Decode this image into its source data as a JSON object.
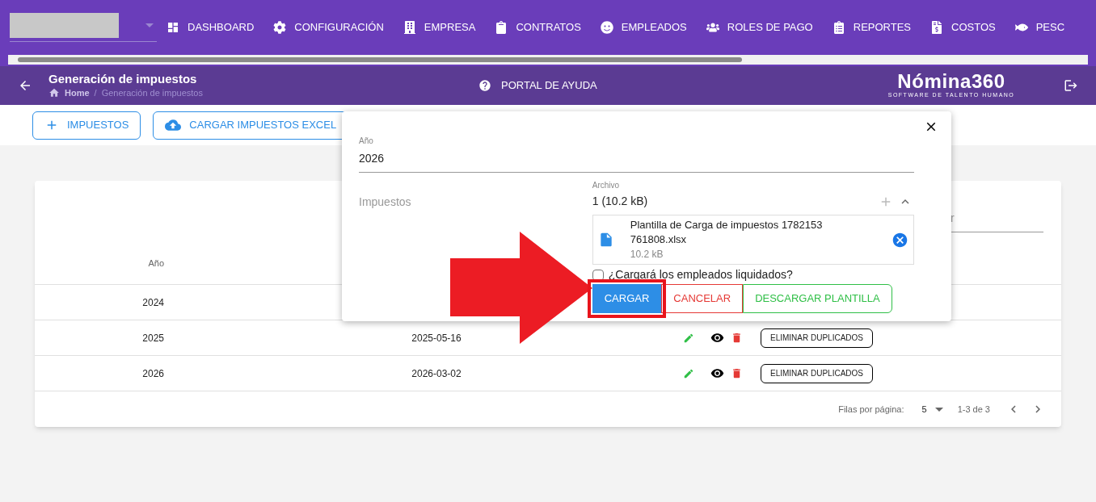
{
  "nav": {
    "items": [
      {
        "label": "DASHBOARD",
        "kind": "dashboard"
      },
      {
        "label": "CONFIGURACIÓN",
        "kind": "gear"
      },
      {
        "label": "EMPRESA",
        "kind": "building"
      },
      {
        "label": "CONTRATOS",
        "kind": "clipboard"
      },
      {
        "label": "EMPLEADOS",
        "kind": "face"
      },
      {
        "label": "ROLES DE PAGO",
        "kind": "users"
      },
      {
        "label": "REPORTES",
        "kind": "list"
      },
      {
        "label": "COSTOS",
        "kind": "invoice"
      },
      {
        "label": "PESC",
        "kind": "fish"
      }
    ]
  },
  "header": {
    "title": "Generación de impuestos",
    "breadcrumb": [
      "Home",
      "Generación de impuestos"
    ],
    "breadcrumb_separator": "/",
    "help": "PORTAL DE AYUDA",
    "logo": "Nómina360",
    "logo_tagline": "SOFTWARE DE TALENTO HUMANO"
  },
  "toolbar": [
    {
      "label": "IMPUESTOS",
      "kind": "add"
    },
    {
      "label": "CARGAR IMPUESTOS EXCEL",
      "kind": "upload"
    }
  ],
  "table": {
    "search_fragment": "r",
    "columns": [
      {
        "label": "Año"
      }
    ],
    "rows": [
      {
        "year": "2024"
      },
      {
        "year": "2025",
        "date": "2025-05-16",
        "action": "ELIMINAR DUPLICADOS"
      },
      {
        "year": "2026",
        "date": "2026-03-02",
        "action": "ELIMINAR DUPLICADOS"
      }
    ],
    "pagination": {
      "label": "Filas por página:",
      "per_page": "5",
      "range": "1-3 de 3"
    }
  },
  "dialog": {
    "year_label": "Año",
    "year_value": "2026",
    "section_label": "Impuestos",
    "file_label": "Archivo",
    "file_summary": "1 (10.2 kB)",
    "files": [
      {
        "name": "Plantilla de Carga de impuestos 1782153761808.xlsx",
        "size": "10.2 kB"
      }
    ],
    "checkbox": {
      "label": "¿Cargará los empleados liquidados?",
      "checked": false
    },
    "buttons": [
      {
        "label": "CARGAR",
        "kind": "primary",
        "highlighted": true
      },
      {
        "label": "CANCELAR",
        "kind": "danger",
        "highlighted": false
      },
      {
        "label": "DESCARGAR PLANTILLA",
        "kind": "success",
        "highlighted": false
      }
    ],
    "pointer_arrow": true
  }
}
